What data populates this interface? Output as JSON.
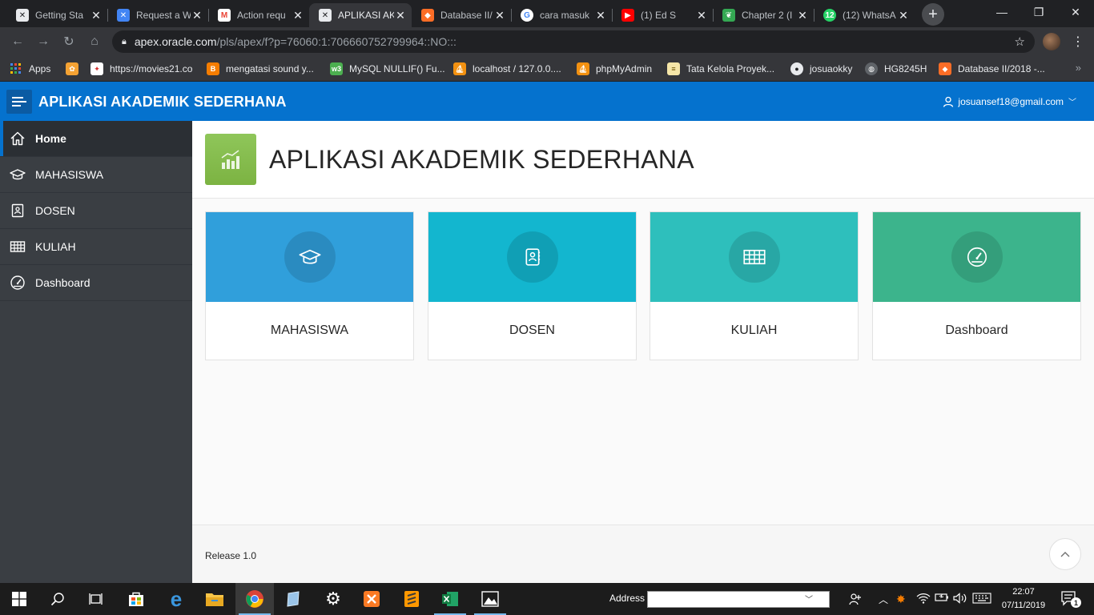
{
  "browser": {
    "tabs": [
      {
        "title": "Getting Sta",
        "icon": "apex-icon",
        "color": "#e8eaed"
      },
      {
        "title": "Request a W",
        "icon": "apex-icon",
        "color": "#4285f4"
      },
      {
        "title": "Action requ",
        "icon": "gmail-icon",
        "color": "#ea4335"
      },
      {
        "title": "APLIKASI AK",
        "icon": "apex-icon",
        "color": "#e8eaed",
        "active": true
      },
      {
        "title": "Database II/",
        "icon": "gitlab-icon",
        "color": "#fc6d26"
      },
      {
        "title": "cara masuk",
        "icon": "google-icon",
        "color": "#4285f4"
      },
      {
        "title": "(1) Ed S",
        "icon": "youtube-icon",
        "color": "#ff0000"
      },
      {
        "title": "Chapter 2 (I",
        "icon": "leaf-icon",
        "color": "#34a853"
      },
      {
        "title": "(12) WhatsA",
        "icon": "whatsapp-icon",
        "color": "#25d366"
      }
    ],
    "url_host": "apex.oracle.com",
    "url_path": "/pls/apex/f?p=76060:1:706660752799964::NO:::",
    "bookmarks": [
      {
        "label": "Apps",
        "icon": "apps-grid-icon"
      },
      {
        "label": "",
        "icon": "bookmark-icon"
      },
      {
        "label": "https://movies21.co",
        "icon": "movies-icon"
      },
      {
        "label": "mengatasi sound y...",
        "icon": "blogger-icon"
      },
      {
        "label": "MySQL NULLIF() Fu...",
        "icon": "w3-icon"
      },
      {
        "label": "localhost / 127.0.0....",
        "icon": "phpmyadmin-icon"
      },
      {
        "label": "phpMyAdmin",
        "icon": "phpmyadmin-icon"
      },
      {
        "label": "Tata Kelola Proyek...",
        "icon": "document-icon"
      },
      {
        "label": "josuaokky",
        "icon": "github-icon"
      },
      {
        "label": "HG8245H",
        "icon": "globe-icon"
      },
      {
        "label": "Database II/2018 -...",
        "icon": "gitlab-icon"
      }
    ]
  },
  "app": {
    "title": "APLIKASI AKADEMIK SEDERHANA",
    "user_email": "josuansef18@gmail.com"
  },
  "sidebar": {
    "items": [
      {
        "label": "Home",
        "icon": "home-icon",
        "active": true
      },
      {
        "label": "MAHASISWA",
        "icon": "graduation-cap-icon"
      },
      {
        "label": "DOSEN",
        "icon": "contact-card-icon"
      },
      {
        "label": "KULIAH",
        "icon": "table-icon"
      },
      {
        "label": "Dashboard",
        "icon": "gauge-icon"
      }
    ]
  },
  "main": {
    "hero_title": "APLIKASI AKADEMIK SEDERHANA",
    "hero_icon": "chart-growth-icon",
    "hero_color": "#8bc34a",
    "cards": [
      {
        "label": "MAHASISWA",
        "icon": "graduation-cap-icon",
        "color": "#309fdb"
      },
      {
        "label": "DOSEN",
        "icon": "contact-card-icon",
        "color": "#13b6cf"
      },
      {
        "label": "KULIAH",
        "icon": "table-icon",
        "color": "#2ebfbc"
      },
      {
        "label": "Dashboard",
        "icon": "gauge-icon",
        "color": "#3cb48c"
      }
    ]
  },
  "footer": {
    "release": "Release 1.0"
  },
  "taskbar": {
    "address_label": "Address",
    "time": "22:07",
    "date": "07/11/2019",
    "notification_count": "1"
  }
}
